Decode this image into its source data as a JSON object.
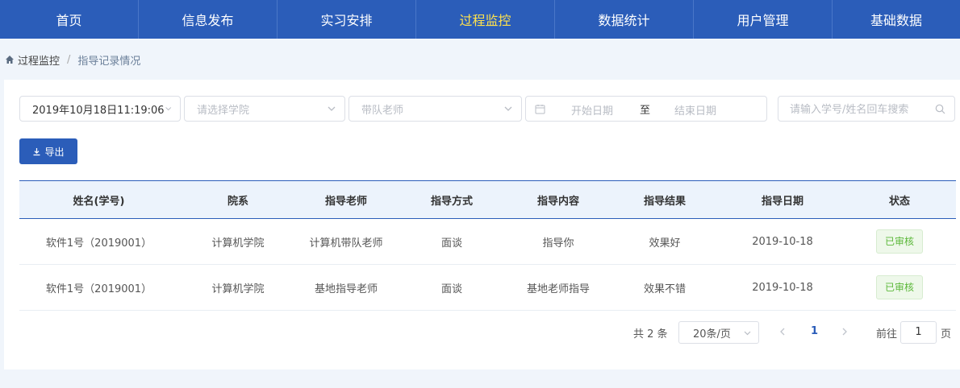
{
  "nav": {
    "items": [
      "首页",
      "信息发布",
      "实习安排",
      "过程监控",
      "数据统计",
      "用户管理",
      "基础数据"
    ],
    "active_index": 3
  },
  "breadcrumb": {
    "parent": "过程监控",
    "separator": "/",
    "current": "指导记录情况"
  },
  "filters": {
    "datetime_value": "2019年10月18日11:19:06",
    "college_placeholder": "请选择学院",
    "teacher_placeholder": "带队老师",
    "start_date_placeholder": "开始日期",
    "range_separator": "至",
    "end_date_placeholder": "结束日期",
    "search_placeholder": "请输入学号/姓名回车搜索"
  },
  "export_label": "导出",
  "table": {
    "columns": [
      "姓名(学号)",
      "院系",
      "指导老师",
      "指导方式",
      "指导内容",
      "指导结果",
      "指导日期",
      "状态"
    ],
    "rows": [
      [
        "软件1号（2019001）",
        "计算机学院",
        "计算机带队老师",
        "面谈",
        "指导你",
        "效果好",
        "2019-10-18",
        "已审核"
      ],
      [
        "软件1号（2019001）",
        "计算机学院",
        "基地指导老师",
        "面谈",
        "基地老师指导",
        "效果不错",
        "2019-10-18",
        "已审核"
      ]
    ]
  },
  "pagination": {
    "total": "共 2 条",
    "page_size": "20条/页",
    "current_page": "1",
    "goto_label": "前往",
    "goto_value": "1",
    "page_unit": "页"
  },
  "colors": {
    "primary": "#2b5db9",
    "nav_active": "#ffe24d",
    "approved": "#5cb83a"
  },
  "icons": {
    "home": "home-icon",
    "chevron": "chevron-down-icon",
    "calendar": "calendar-icon",
    "search": "search-icon",
    "download": "download-icon"
  }
}
